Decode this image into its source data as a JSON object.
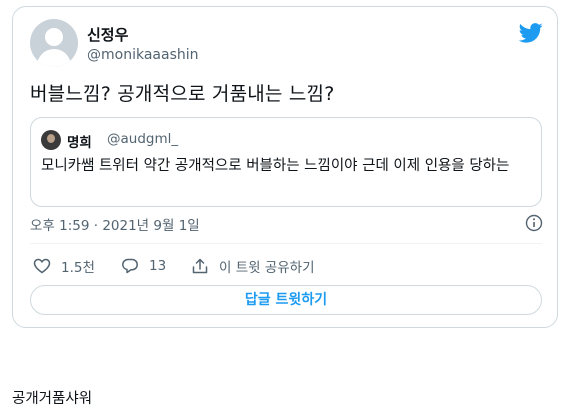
{
  "tweet": {
    "display_name": "신정우",
    "handle": "@monikaaashin",
    "text": "버블느낌? 공개적으로 거품내는 느낌?",
    "timestamp": "오후 1:59 · 2021년 9월 1일",
    "brand_icon": "twitter-bird-icon",
    "accent_color": "#1d9bf0"
  },
  "quote": {
    "display_name": "명희",
    "handle": "@audgml_",
    "text": "모니카쌤 트위터 약간 공개적으로 버블하는 느낌이야 근데 이제 인용을 당하는"
  },
  "actions": {
    "likes": "1.5천",
    "replies": "13",
    "share_label": "이 트윗 공유하기",
    "reply_button": "답글 트윗하기"
  },
  "caption": "공개거품샤워"
}
